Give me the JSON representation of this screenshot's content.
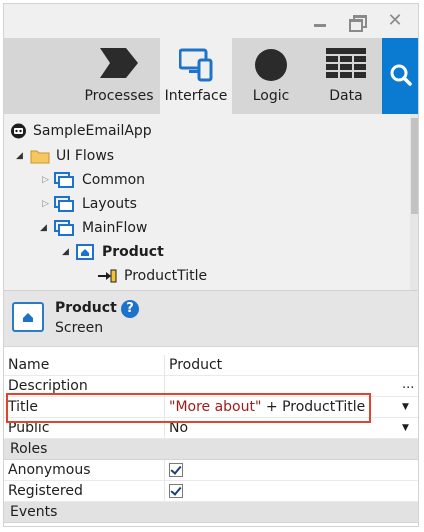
{
  "tabs": [
    {
      "label": "Processes",
      "icon": "processes-icon"
    },
    {
      "label": "Interface",
      "icon": "interface-icon",
      "active": true
    },
    {
      "label": "Logic",
      "icon": "logic-icon"
    },
    {
      "label": "Data",
      "icon": "data-icon"
    }
  ],
  "search": {
    "icon": "search-icon"
  },
  "tree": {
    "app": "SampleEmailApp",
    "ui_flows": "UI Flows",
    "common": "Common",
    "layouts": "Layouts",
    "mainflow": "MainFlow",
    "product": "Product",
    "product_title": "ProductTitle"
  },
  "header": {
    "name": "Product",
    "type": "Screen",
    "help": "?"
  },
  "properties": {
    "name_key": "Name",
    "name_value": "Product",
    "description_key": "Description",
    "description_dots": "...",
    "title_key": "Title",
    "title_string": "\"More about\"",
    "title_rest": " + ProductTitle",
    "public_key": "Public",
    "public_value": "No",
    "roles_section": "Roles",
    "anonymous_key": "Anonymous",
    "anonymous_checked": true,
    "registered_key": "Registered",
    "registered_checked": true,
    "events_section": "Events"
  },
  "colors": {
    "accent": "#0a7bd1",
    "highlight": "#e0442b",
    "string_literal": "#a01c1c"
  }
}
